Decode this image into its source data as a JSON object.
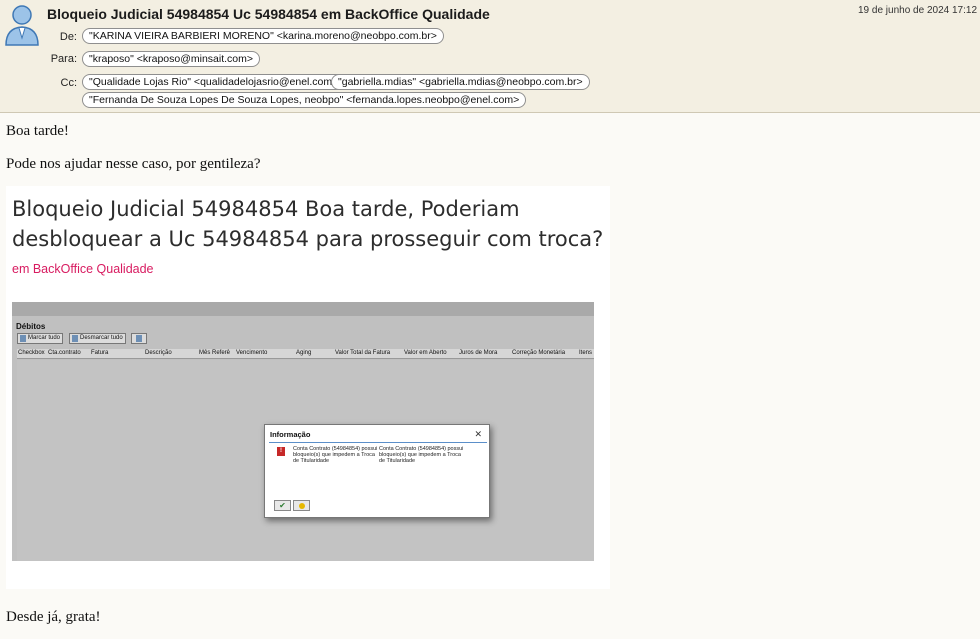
{
  "email": {
    "subject": "Bloqueio Judicial 54984854 Uc 54984854 em BackOffice Qualidade",
    "date": "19 de junho de 2024 17:12",
    "from_label": "De:",
    "from": "\"KARINA VIEIRA BARBIERI MORENO\" <karina.moreno@neobpo.com.br>",
    "to_label": "Para:",
    "to": "\"kraposo\" <kraposo@minsait.com>",
    "cc_label": "Cc:",
    "cc": [
      "\"Qualidade Lojas Rio\" <qualidadelojasrio@enel.com>",
      "\"gabriella.mdias\" <gabriella.mdias@neobpo.com.br>",
      "\"Fernanda De Souza Lopes De Souza Lopes, neobpo\" <fernanda.lopes.neobpo@enel.com>"
    ]
  },
  "body": {
    "greeting": "Boa tarde!",
    "request": "Pode nos ajudar nesse caso, por gentileza?",
    "closing": "Desde já, grata!"
  },
  "card": {
    "title": "Bloqueio Judicial 54984854 Boa tarde, Poderiam desbloquear a Uc 54984854 para prosseguir com troca?",
    "subtitle": "em BackOffice Qualidade",
    "subtitle_color": "#d81b60"
  },
  "sap": {
    "panel_title": "Débitos",
    "buttons": [
      "Marcar tudo",
      "Desmarcar tudo"
    ],
    "columns": [
      "Checkbox",
      "Cta.contrato",
      "Fatura",
      "Descrição",
      "Mês Referê",
      "Vencimento",
      "Aging",
      "Valor Total da Fatura",
      "Valor em Aberto",
      "Juros de Mora",
      "Correção Monetária",
      "Itens"
    ],
    "dialog": {
      "title": "Informação",
      "message_1": "Conta Contrato (54984854) possui bloqueio(s) que impedem a Troca de Titularidade",
      "message_2": "Conta Contrato (54984854) possui bloqueio(s) que impedem a Troca de Titularidade",
      "close_glyph": "✕",
      "ok_glyph": "✔",
      "error_glyph": "!"
    }
  }
}
